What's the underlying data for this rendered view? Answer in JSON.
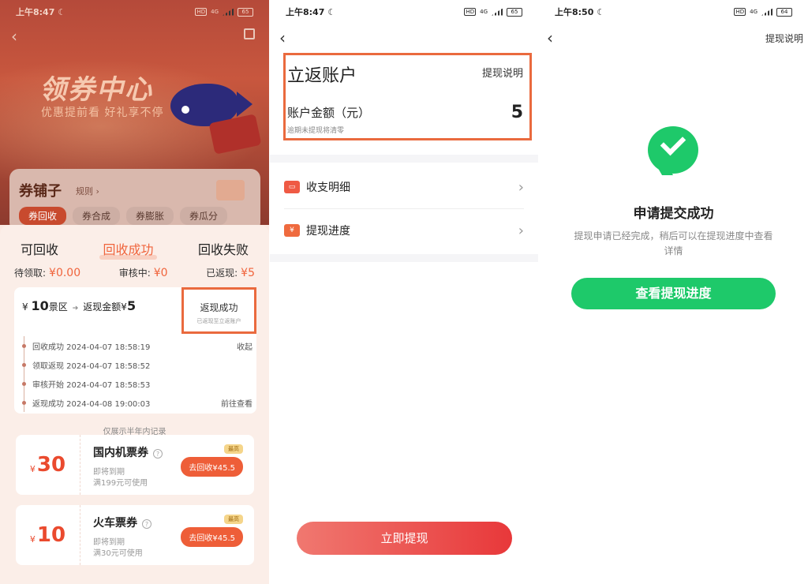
{
  "panel1": {
    "status": {
      "time": "上午8:47",
      "battery": "65",
      "network": "4G"
    },
    "banner": {
      "title": "领券中心",
      "subtitle": "优惠提前看 好礼享不停"
    },
    "store": {
      "name": "券铺子",
      "rule": "规则 ›",
      "tabs": [
        "券回收",
        "券合成",
        "券膨胀",
        "券瓜分"
      ]
    },
    "sheet_tabs": [
      "可回收",
      "回收成功",
      "回收失败"
    ],
    "stats": [
      {
        "label": "待领取:",
        "value": "¥0.00"
      },
      {
        "label": "审核中:",
        "value": "¥0"
      },
      {
        "label": "已返现:",
        "value": "¥5"
      }
    ],
    "record": {
      "currency": "¥",
      "coupon": "10",
      "coupon_unit": "景区",
      "cashback_label": "返现金额¥",
      "cashback": "5",
      "status": "返现成功",
      "status_note": "已返现至立返账户",
      "timeline": [
        {
          "text": "回收成功 2024-04-07 18:58:19",
          "action": "收起"
        },
        {
          "text": "领取返现 2024-04-07 18:58:52",
          "action": ""
        },
        {
          "text": "审核开始 2024-04-07 18:58:53",
          "action": ""
        },
        {
          "text": "返现成功 2024-04-08 19:00:03",
          "action": "前往查看"
        }
      ]
    },
    "note": "仅展示半年内记录",
    "coupons": [
      {
        "currency": "¥",
        "value": "30",
        "name": "国内机票券",
        "expire": "即将到期",
        "condition": "满199元可使用",
        "tag": "最高",
        "button": "去回收¥45.5"
      },
      {
        "currency": "¥",
        "value": "10",
        "name": "火车票券",
        "expire": "即将到期",
        "condition": "满30元可使用",
        "tag": "最高",
        "button": "去回收¥45.5"
      }
    ]
  },
  "panel2": {
    "status": {
      "time": "上午8:47",
      "battery": "65",
      "network": "4G"
    },
    "title": "立返账户",
    "explain": "提现说明",
    "amount_label": "账户金额（元）",
    "amount": "5",
    "warning": "逾期未提现将清零",
    "menu": [
      "收支明细",
      "提现进度"
    ],
    "button": "立即提现"
  },
  "panel3": {
    "status": {
      "time": "上午8:50",
      "battery": "64",
      "network": "4G"
    },
    "explain": "提现说明",
    "title": "申请提交成功",
    "desc": "提现申请已经完成，稍后可以在提现进度中查看详情",
    "button": "查看提现进度"
  },
  "colors": {
    "accent": "#ea6a3e",
    "green": "#1ec96a",
    "red": "#e8383a"
  }
}
